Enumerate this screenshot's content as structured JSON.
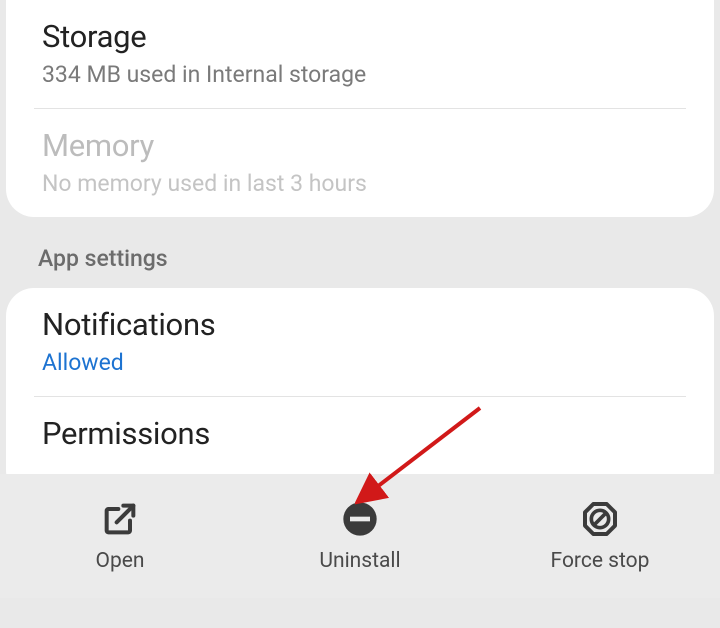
{
  "usage": {
    "storage": {
      "title": "Storage",
      "subtitle": "334 MB used in Internal storage"
    },
    "memory": {
      "title": "Memory",
      "subtitle": "No memory used in last 3 hours"
    }
  },
  "section_header": "App settings",
  "settings": {
    "notifications": {
      "title": "Notifications",
      "status": "Allowed"
    },
    "permissions": {
      "title": "Permissions"
    }
  },
  "actions": {
    "open": {
      "label": "Open"
    },
    "uninstall": {
      "label": "Uninstall"
    },
    "forcestop": {
      "label": "Force stop"
    }
  }
}
